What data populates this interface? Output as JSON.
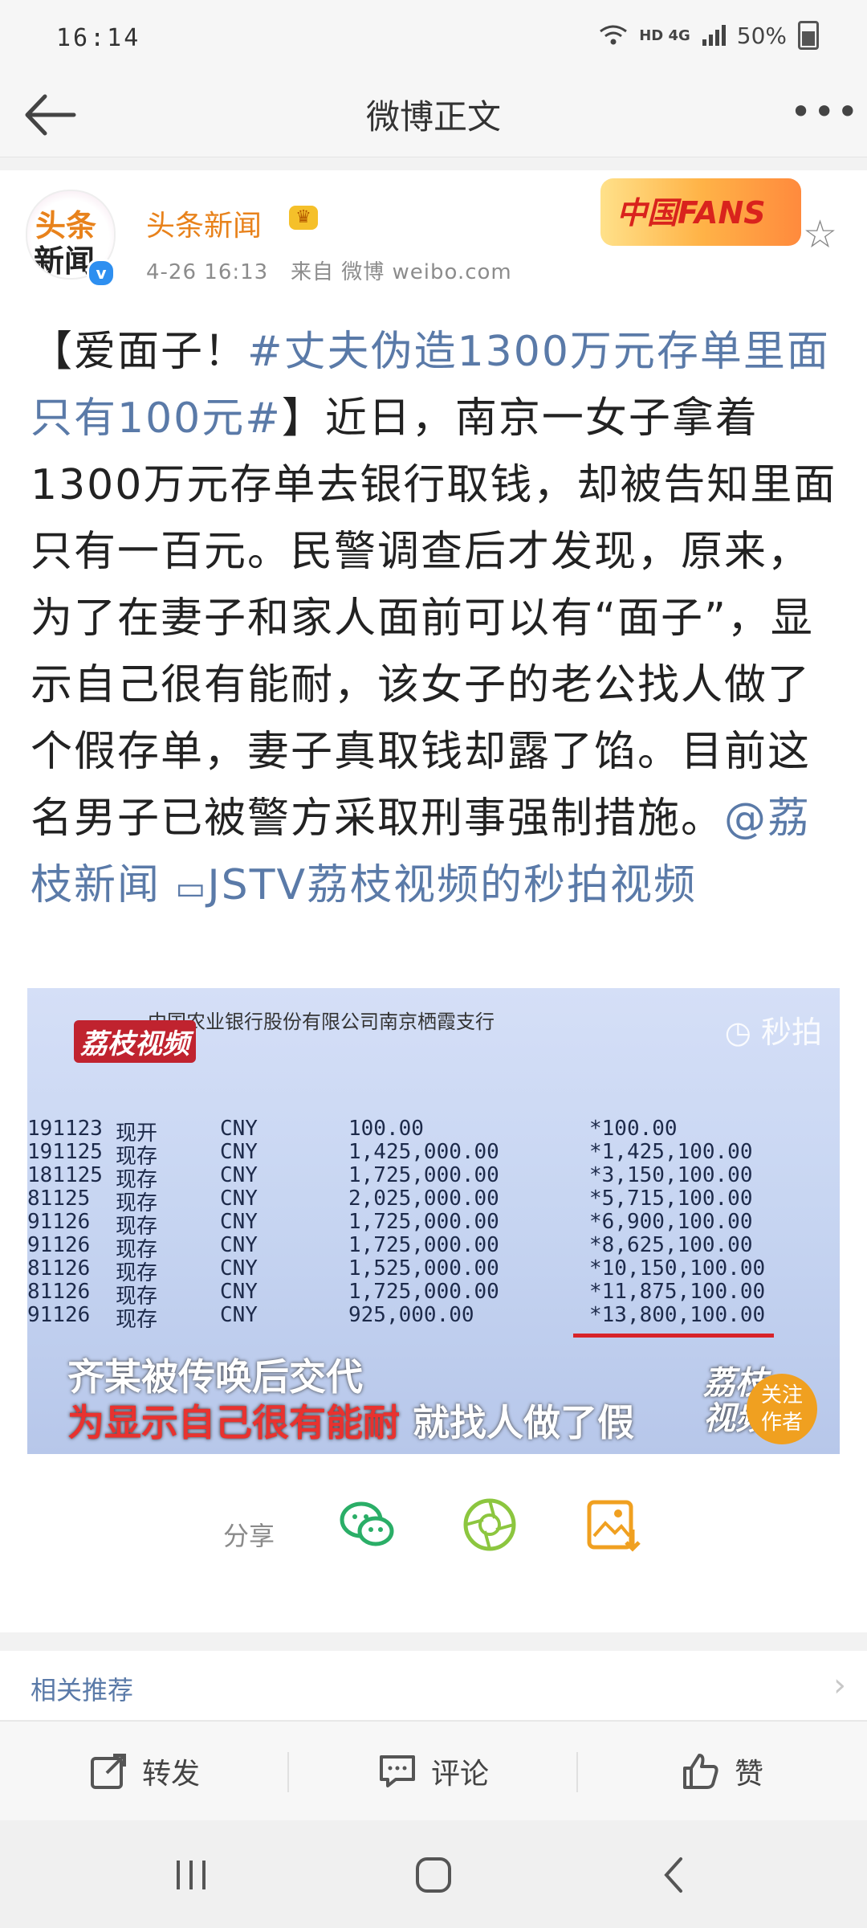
{
  "status_bar": {
    "time": "16:14",
    "battery": "50%",
    "network": "HD 4G"
  },
  "nav": {
    "title": "微博正文",
    "back_icon": "back-arrow-icon",
    "more_icon": "more-icon"
  },
  "post": {
    "author": "头条新闻",
    "avatar_text_top": "头条",
    "avatar_text_bottom": "新闻",
    "time": "4-26 16:13",
    "source": "来自 微博 weibo.com",
    "badge": "中国FANS",
    "body_prefix": "【爱面子！",
    "hashtag": "#丈夫伪造1300万元存单里面只有100元#",
    "body_main": "】近日，南京一女子拿着1300万元存单去银行取钱，却被告知里面只有一百元。民警调查后才发现，原来，为了在妻子和家人面前可以有“面子”，显示自己很有能耐，该女子的老公找人做了个假存单，妻子真取钱却露了馅。目前这名男子已被警方采取刑事强制措施。",
    "mention": "@荔枝新闻",
    "video_link": "JSTV荔枝视频的秒拍视频"
  },
  "video": {
    "bank_header": "中国农业银行股份有限公司南京栖霞支行",
    "logo": "荔枝视频",
    "watermark": "秒拍",
    "rows": [
      {
        "id": "191123",
        "type": "现开",
        "cur": "CNY",
        "amount": "100.00",
        "balance": "*100.00"
      },
      {
        "id": "191125",
        "type": "现存",
        "cur": "CNY",
        "amount": "1,425,000.00",
        "balance": "*1,425,100.00"
      },
      {
        "id": "181125",
        "type": "现存",
        "cur": "CNY",
        "amount": "1,725,000.00",
        "balance": "*3,150,100.00"
      },
      {
        "id": "81125",
        "type": "现存",
        "cur": "CNY",
        "amount": "2,025,000.00",
        "balance": "*5,715,100.00"
      },
      {
        "id": "91126",
        "type": "现存",
        "cur": "CNY",
        "amount": "1,725,000.00",
        "balance": "*6,900,100.00"
      },
      {
        "id": "91126",
        "type": "现存",
        "cur": "CNY",
        "amount": "1,725,000.00",
        "balance": "*8,625,100.00"
      },
      {
        "id": "81126",
        "type": "现存",
        "cur": "CNY",
        "amount": "1,525,000.00",
        "balance": "*10,150,100.00"
      },
      {
        "id": "81126",
        "type": "现存",
        "cur": "CNY",
        "amount": "1,725,000.00",
        "balance": "*11,875,100.00"
      },
      {
        "id": "91126",
        "type": "现存",
        "cur": "CNY",
        "amount": "925,000.00",
        "balance": "*13,800,100.00"
      }
    ],
    "subtitle_1": "齐某被传唤后交代",
    "subtitle_2_red": "为显示自己很有能耐",
    "subtitle_2_rest": " 就找人做了假",
    "brand_1": "荔枝",
    "brand_2": "视频",
    "follow_1": "关注",
    "follow_2": "作者"
  },
  "share": {
    "label": "分享",
    "icons": [
      "wechat-icon",
      "moments-icon",
      "save-image-icon"
    ]
  },
  "related": {
    "label": "相关推荐"
  },
  "actions": {
    "forward": "转发",
    "comment": "评论",
    "like": "赞"
  },
  "colors": {
    "author": "#e8821b",
    "link": "#5a7aa8",
    "wechat": "#2aae67",
    "moments": "#8cc63f",
    "save": "#f0a020"
  }
}
